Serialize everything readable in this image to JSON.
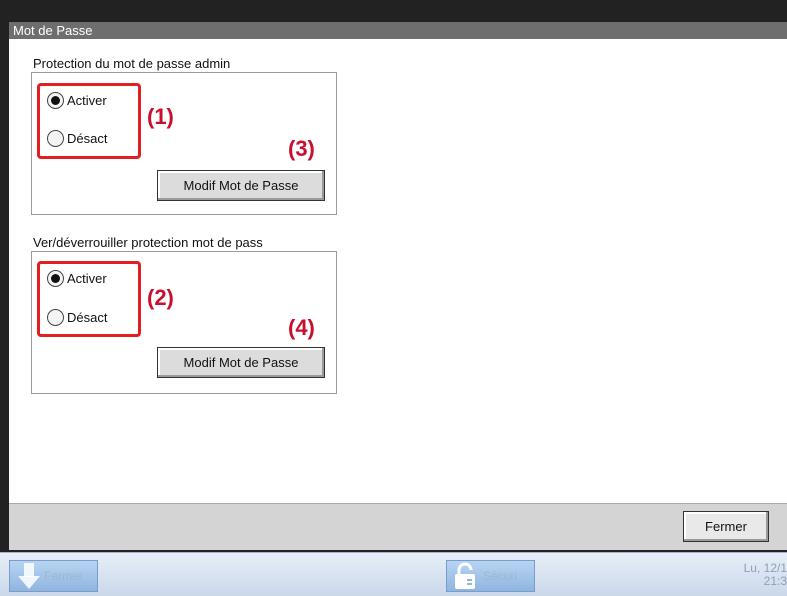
{
  "window": {
    "title": "Mot de Passe"
  },
  "groups": [
    {
      "title": "Protection du mot de passe admin",
      "options": [
        {
          "label": "Activer",
          "checked": true
        },
        {
          "label": "Désact",
          "checked": false
        }
      ],
      "annotation_radio": "(1)",
      "annotation_button": "(3)",
      "button_label": "Modif Mot de Passe"
    },
    {
      "title": "Ver/déverrouiller protection mot de pass",
      "options": [
        {
          "label": "Activer",
          "checked": true
        },
        {
          "label": "Désact",
          "checked": false
        }
      ],
      "annotation_radio": "(2)",
      "annotation_button": "(4)",
      "button_label": "Modif Mot de Passe"
    }
  ],
  "footer": {
    "close_label": "Fermer"
  },
  "taskbar": {
    "left_label": "Fermer",
    "center_label": "Sécuri",
    "date": "Lu, 12/1",
    "time": "21:3"
  },
  "colors": {
    "annotation": "#c8102e",
    "highlight": "#e02020"
  },
  "icons": [
    "down-arrow-icon",
    "lock-icon"
  ]
}
